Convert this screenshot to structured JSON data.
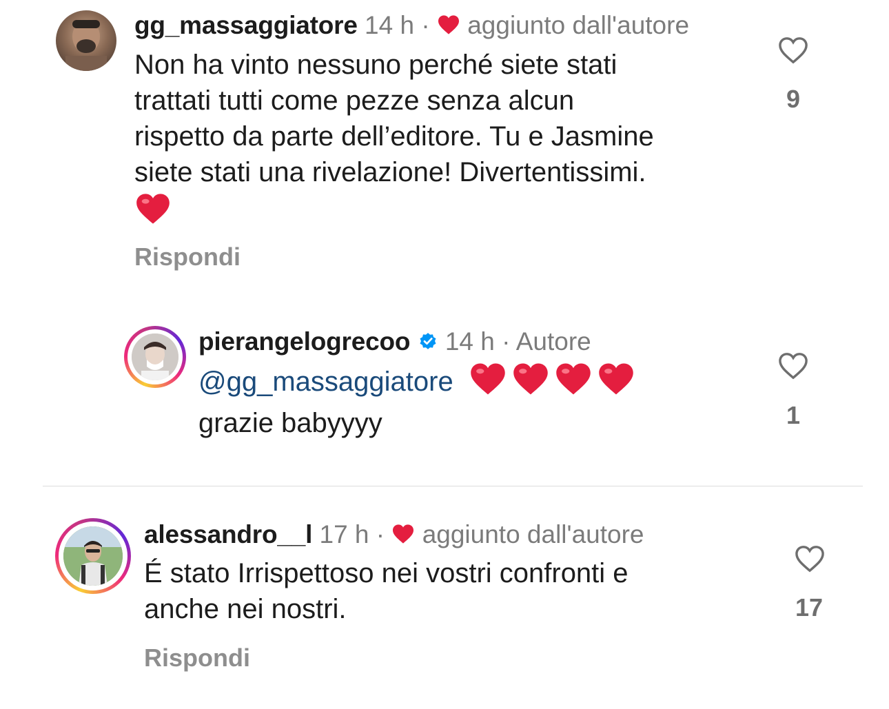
{
  "comments": [
    {
      "username": "gg_massaggiatore",
      "time": "14 h",
      "separator": "·",
      "badge_text": "aggiunto dall'autore",
      "text_lines": [
        "Non ha vinto nessuno perché siete stati",
        "trattati tutti come pezze senza alcun",
        "rispetto da parte dell’editore. Tu e Jasmine",
        "siete stati una rivelazione! Divertentissimi."
      ],
      "emoji": "red-heart-emoji",
      "reply_label": "Rispondi",
      "like_count": "9"
    },
    {
      "username": "pierangelogrecoo",
      "verified": true,
      "time": "14 h",
      "separator": "·",
      "role": "Autore",
      "mention": "@gg_massaggiatore",
      "emoji_count": 4,
      "text_line2": "grazie babyyyy",
      "like_count": "1"
    },
    {
      "username": "alessandro__l",
      "time": "17 h",
      "separator": "·",
      "badge_text": "aggiunto dall'autore",
      "text_lines": [
        "É stato Irrispettoso nei vostri confronti e",
        "anche nei nostri."
      ],
      "reply_label": "Rispondi",
      "like_count": "17"
    }
  ],
  "colors": {
    "text": "#1c1c1c",
    "muted": "#7b7b7b",
    "heart_red": "#e41e3f",
    "mention_blue": "#1a4a7a",
    "verified_blue": "#0095f6"
  }
}
